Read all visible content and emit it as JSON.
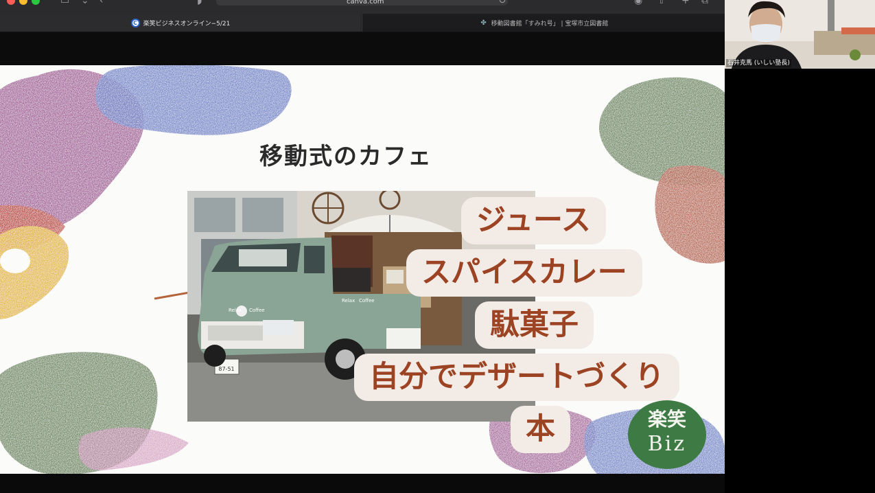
{
  "browser": {
    "address": "canva.com",
    "tabs": [
      {
        "label": "楽笑ビジネスオンライン−5/21",
        "active": true,
        "icon": "canva-icon"
      },
      {
        "label": "移動図書館「すみれ号」 | 宝塚市立図書館",
        "active": false,
        "icon": "library-favicon-icon"
      }
    ]
  },
  "slide": {
    "title": "移動式のカフェ",
    "items": [
      {
        "text": "ジュース"
      },
      {
        "text": "スパイスカレー"
      },
      {
        "text": "駄菓子"
      },
      {
        "text": "自分でデザートづくり"
      },
      {
        "text": "本"
      }
    ],
    "photo": {
      "van_labels": [
        "Relax",
        "Coffee"
      ],
      "plate": [
        "87-51"
      ]
    },
    "logo": {
      "top": "楽笑",
      "bottom": "Biz"
    }
  },
  "video": {
    "participant_name": "石井克馬 (いしい塾長)"
  },
  "colors": {
    "item_text": "#9b4322",
    "item_bg": "#f3ebe6",
    "logo_bg": "#3e7a44",
    "van_body": "#8aa596"
  }
}
